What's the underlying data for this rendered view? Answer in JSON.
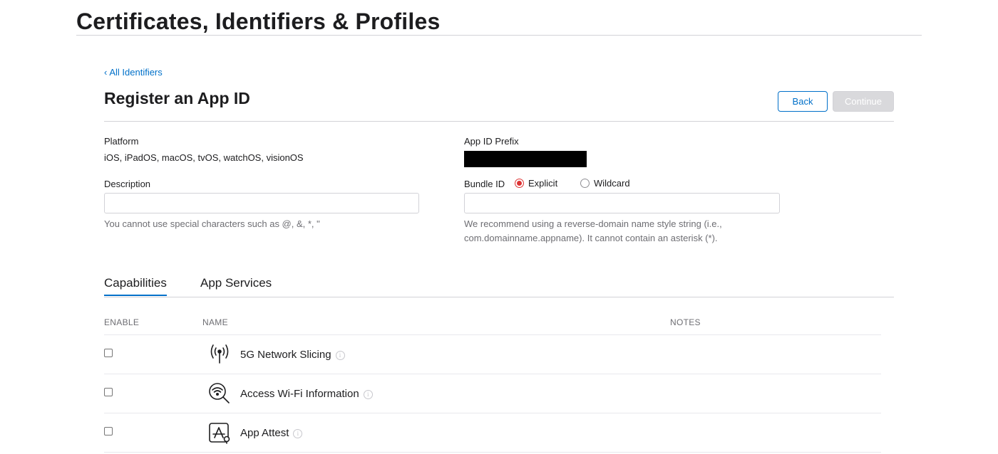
{
  "header": {
    "title": "Certificates, Identifiers & Profiles"
  },
  "nav": {
    "back_link": "All Identifiers"
  },
  "form": {
    "title": "Register an App ID",
    "back_button": "Back",
    "continue_button": "Continue",
    "platform": {
      "label": "Platform",
      "value": "iOS, iPadOS, macOS, tvOS, watchOS, visionOS"
    },
    "prefix": {
      "label": "App ID Prefix"
    },
    "description": {
      "label": "Description",
      "value": "",
      "help": "You cannot use special characters such as @, &, *, \""
    },
    "bundle": {
      "label": "Bundle ID",
      "options": [
        {
          "label": "Explicit",
          "selected": true
        },
        {
          "label": "Wildcard",
          "selected": false
        }
      ],
      "value": "",
      "help_line1": "We recommend using a reverse-domain name style string (i.e.,",
      "help_line2": "com.domainname.appname). It cannot contain an asterisk (*)."
    }
  },
  "tabs": [
    {
      "label": "Capabilities",
      "active": true
    },
    {
      "label": "App Services",
      "active": false
    }
  ],
  "table": {
    "columns": [
      "ENABLE",
      "NAME",
      "NOTES"
    ],
    "rows": [
      {
        "name": "5G Network Slicing",
        "icon": "antenna-icon",
        "enabled": false
      },
      {
        "name": "Access Wi-Fi Information",
        "icon": "wifi-search-icon",
        "enabled": false
      },
      {
        "name": "App Attest",
        "icon": "app-attest-icon",
        "enabled": false
      }
    ]
  },
  "colors": {
    "accent": "#0070c9",
    "radio_selected": "#dd3333",
    "disabled_button": "#d9d9dc"
  }
}
